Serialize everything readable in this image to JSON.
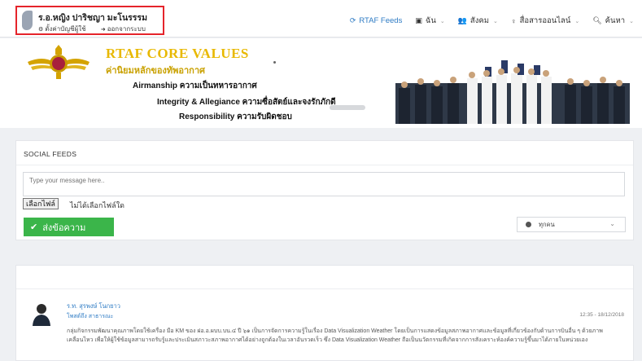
{
  "user": {
    "name": "ร.อ.หญิง ปาริชญา มะโนรรรม",
    "settings_label": "ตั้งค่าบัญชีผู้ใช้",
    "logout_label": "ออกจากระบบ"
  },
  "nav": {
    "feeds": "RTAF Feeds",
    "me": "ฉัน",
    "social": "สังคม",
    "media": "สื่อสารออนไลน์",
    "search": "ค้นหา"
  },
  "banner": {
    "title": "RTAF CORE VALUES",
    "subtitle": "ค่านิยมหลักของทัพอากาศ",
    "value1": "Airmanship ความเป็นทหารอากาศ",
    "value2": "Integrity & Allegiance ความซื่อสัตย์และจงรักภักดี",
    "value3": "Responsibility ความรับผิดชอบ"
  },
  "social_feeds": {
    "title": "SOCIAL FEEDS",
    "message_placeholder": "Type your message here..",
    "file_button": "เลือกไฟล์",
    "file_status": "ไม่ได้เลือกไฟล์ใด",
    "send_button": "ส่งข้อความ",
    "audience": "ทุกคน"
  },
  "post": {
    "author": "ร.ท. สุรพงษ์ โนกยาว",
    "visibility": "โพสต์ถึง สาธารณะ",
    "time": "12:35 - 18/12/2018",
    "body": "กลุ่มกิจกรรมพัฒนาคุณภาพโดยใช้เครื่อง มือ KM ของ ฝอ.อ.ผบบ.บน.๔ ปี ๖๑ เป็นการจัดการความรู้ในเรื่อง Data Visualization Weather โดยเป็นการแสดงข้อมูลสภาพอากาศและข้อมูลที่เกี่ยวข้องกับด้านการบินอื่น ๆ ด้วยภาพเคลื่อนไหว เพื่อให้ผู้ใช้ข้อมูลสามารถรับรู้และประเมินสภาวะสภาพอากาศได้อย่างถูกต้องในเวลาอันรวดเร็ว ซึ่ง Data Visualization Weather ถือเป็นนวัตกรรมที่เกิดจากการสังเคราะห์องค์ความรู้ขึ้นมาได้ภายในหน่วยเอง"
  },
  "colors": {
    "accent_blue": "#2e7bc4",
    "send_green": "#3bb54a",
    "highlight_red": "#e5242b",
    "banner_gold": "#e8b800"
  }
}
